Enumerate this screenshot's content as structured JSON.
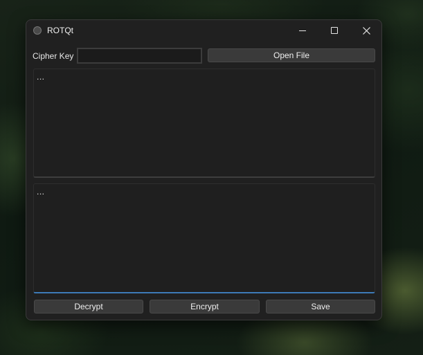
{
  "window": {
    "title": "ROTQt",
    "accent_color": "#3d7bb8",
    "background_color": "#202020",
    "icons": {
      "app": "app-circle-icon",
      "minimize": "minimize-icon",
      "maximize": "maximize-icon",
      "close": "close-icon"
    }
  },
  "cipher": {
    "label": "Cipher Key",
    "value": ""
  },
  "buttons": {
    "open_file": "Open File",
    "decrypt": "Decrypt",
    "encrypt": "Encrypt",
    "save": "Save"
  },
  "text_areas": {
    "input": "...",
    "output": "..."
  }
}
